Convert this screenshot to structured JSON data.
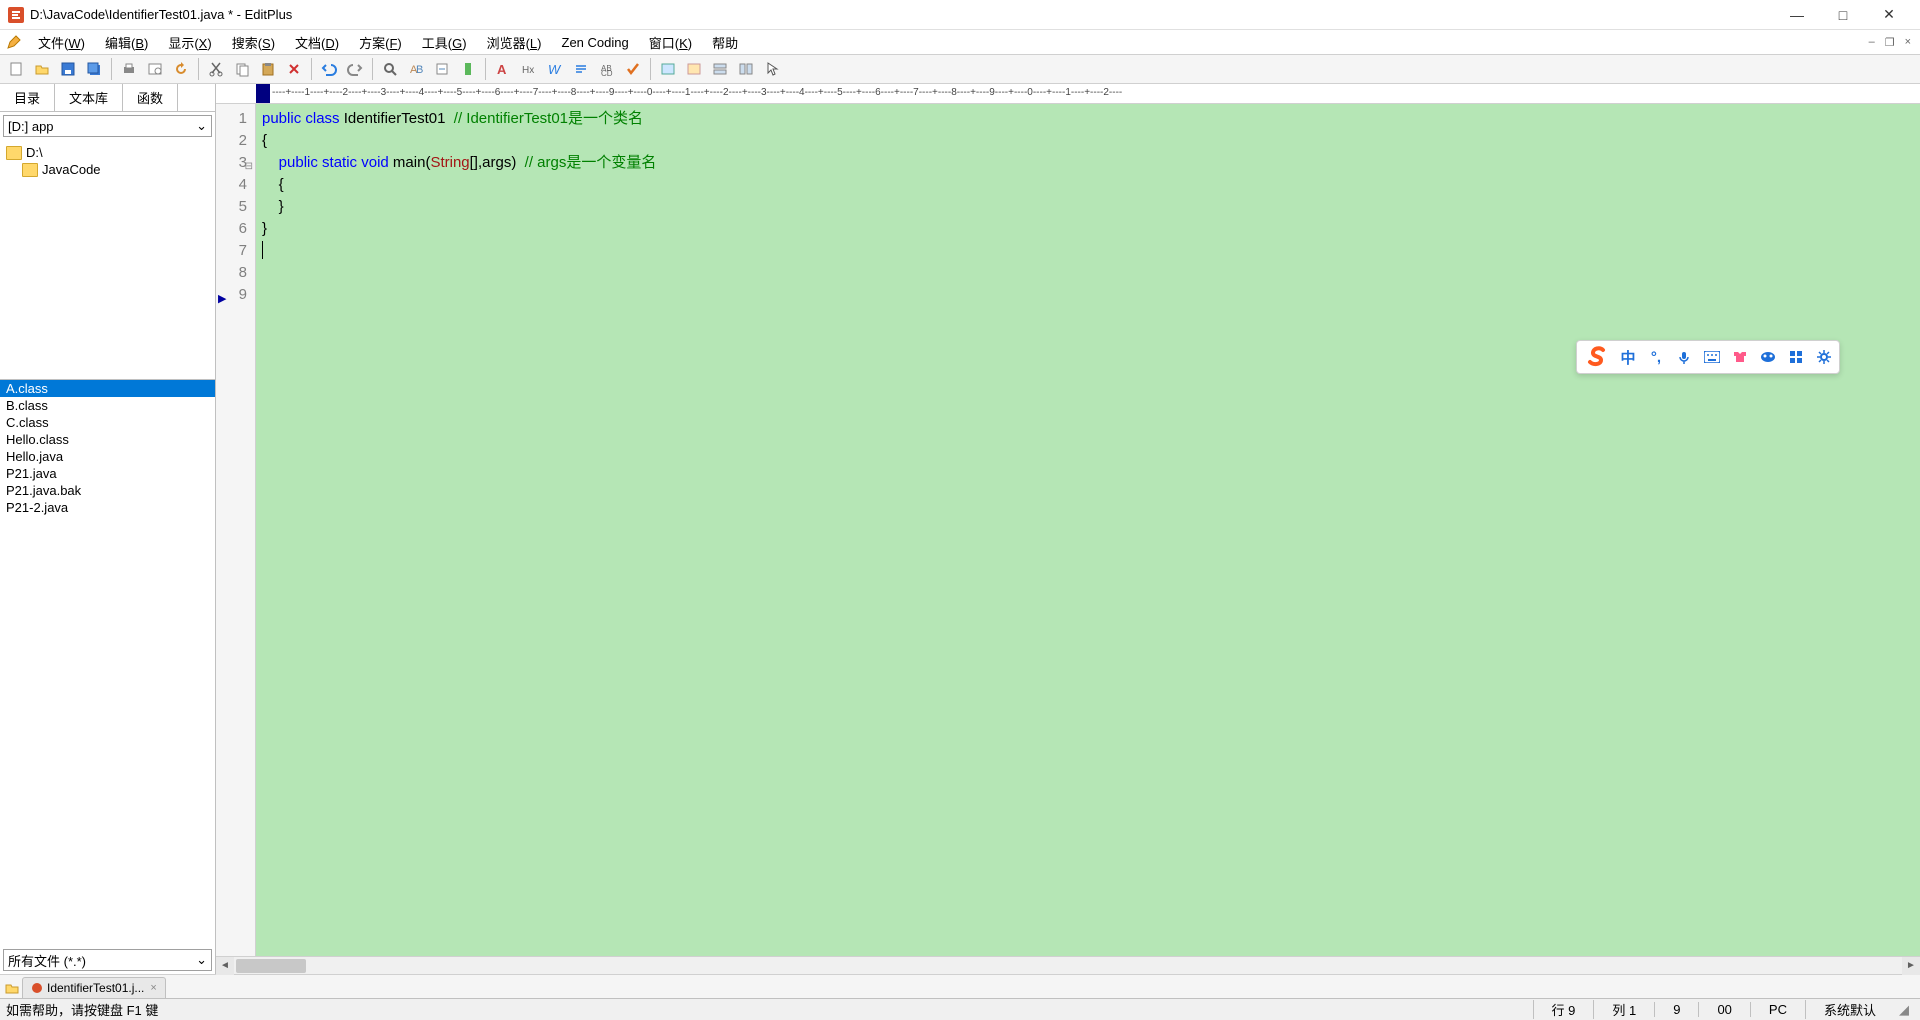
{
  "window": {
    "title": "D:\\JavaCode\\IdentifierTest01.java * - EditPlus"
  },
  "menus": [
    "文件(W)",
    "编辑(B)",
    "显示(X)",
    "搜索(S)",
    "文档(D)",
    "方案(F)",
    "工具(G)",
    "浏览器(L)",
    "Zen Coding",
    "窗口(K)",
    "帮助"
  ],
  "sidebar": {
    "tabs": [
      "目录",
      "文本库",
      "函数"
    ],
    "drive": "[D:] app",
    "folders": [
      "D:\\",
      "JavaCode"
    ],
    "files": [
      "A.class",
      "B.class",
      "C.class",
      "Hello.class",
      "Hello.java",
      "P21.java",
      "P21.java.bak",
      "P21-2.java"
    ],
    "selected_file_index": 0,
    "filter": "所有文件 (*.*)"
  },
  "ruler_text": "----+----1----+----2----+----3----+----4----+----5----+----6----+----7----+----8----+----9----+----0----+----1----+----2----+----3----+----4----+----5----+----6----+----7----+----8----+----9----+----0----+----1----+----2----",
  "code": {
    "lines": [
      {
        "n": "1",
        "frags": [
          {
            "t": "",
            "c": ""
          }
        ]
      },
      {
        "n": "2",
        "frags": [
          {
            "t": "public",
            "c": "kw"
          },
          {
            "t": " ",
            "c": ""
          },
          {
            "t": "class",
            "c": "kw"
          },
          {
            "t": " IdentifierTest01  ",
            "c": ""
          },
          {
            "t": "// IdentifierTest01是一个类名",
            "c": "cm"
          }
        ]
      },
      {
        "n": "3",
        "fold": "⊟",
        "frags": [
          {
            "t": "{",
            "c": ""
          }
        ]
      },
      {
        "n": "4",
        "frags": [
          {
            "t": "    ",
            "c": ""
          },
          {
            "t": "public",
            "c": "kw"
          },
          {
            "t": " ",
            "c": ""
          },
          {
            "t": "static",
            "c": "kw"
          },
          {
            "t": " ",
            "c": ""
          },
          {
            "t": "void",
            "c": "kw"
          },
          {
            "t": " main(",
            "c": ""
          },
          {
            "t": "String",
            "c": "cls"
          },
          {
            "t": "[],args)  ",
            "c": ""
          },
          {
            "t": "// args是一个变量名",
            "c": "cm"
          }
        ]
      },
      {
        "n": "5",
        "frags": [
          {
            "t": "    {",
            "c": ""
          }
        ]
      },
      {
        "n": "6",
        "frags": [
          {
            "t": "",
            "c": ""
          }
        ]
      },
      {
        "n": "7",
        "frags": [
          {
            "t": "    }",
            "c": ""
          }
        ]
      },
      {
        "n": "8",
        "frags": [
          {
            "t": "}",
            "c": ""
          }
        ]
      },
      {
        "n": "9",
        "mark": "▶",
        "caret": true,
        "frags": [
          {
            "t": "",
            "c": ""
          }
        ]
      }
    ]
  },
  "doctab": {
    "label": "IdentifierTest01.j..."
  },
  "status": {
    "help": "如需帮助，请按键盘 F1 键",
    "line": "行 9",
    "col": "列 1",
    "chars": "9",
    "sel": "00",
    "enc": "PC",
    "lang": "系统默认"
  },
  "ime": {
    "lang": "中"
  }
}
